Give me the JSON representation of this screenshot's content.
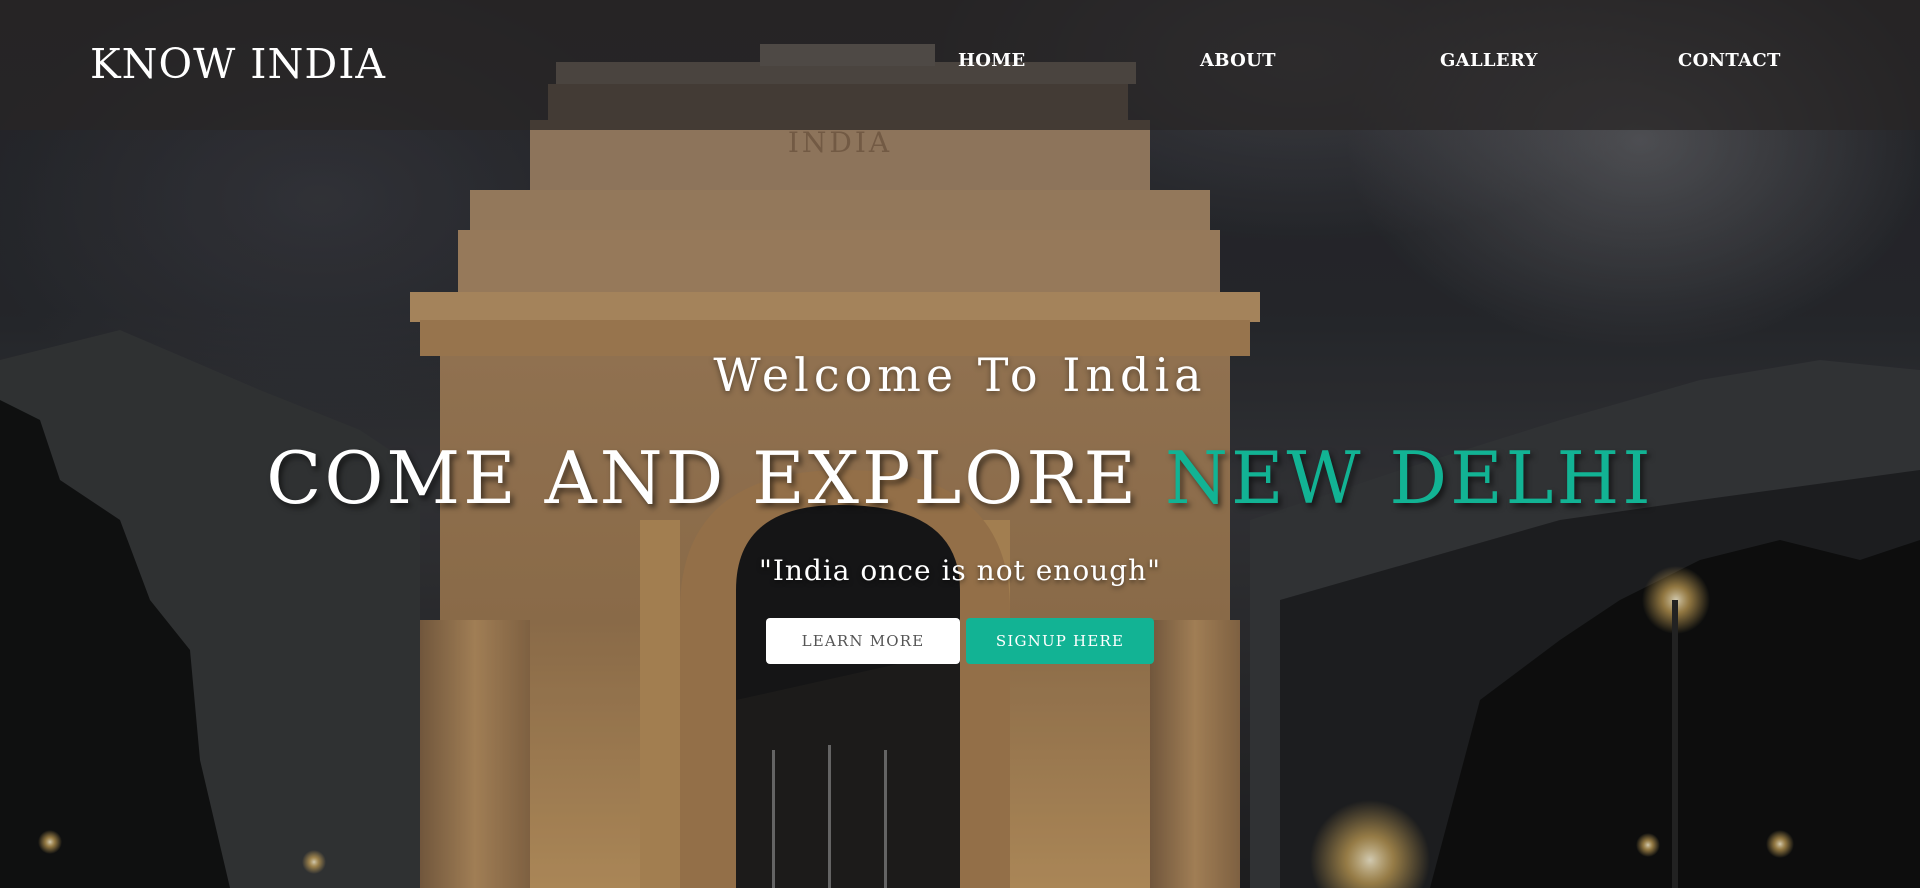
{
  "brand": {
    "name": "KNOW INDIA"
  },
  "nav": {
    "items": [
      {
        "label": "HOME"
      },
      {
        "label": "ABOUT"
      },
      {
        "label": "GALLERY"
      },
      {
        "label": "CONTACT"
      }
    ]
  },
  "hero": {
    "background_image": "india-gate-night-photo",
    "monument_inscription": "INDIA",
    "welcome": "Welcome To India",
    "headline_white": "COME AND EXPLORE ",
    "headline_teal": "NEW DELHI",
    "quote": "\"India once is not enough\"",
    "learn_more_label": "LEARN MORE",
    "signup_label": "SIGNUP HERE"
  },
  "colors": {
    "accent": "#12b394",
    "nav_bg": "#282626",
    "text": "#ffffff"
  }
}
